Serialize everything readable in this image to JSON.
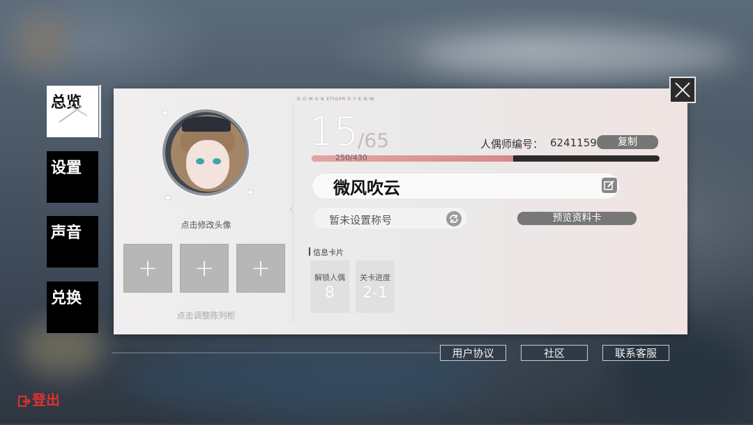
{
  "nav": {
    "items": [
      {
        "label": "总览",
        "active": true
      },
      {
        "label": "设置",
        "active": false
      },
      {
        "label": "声音",
        "active": false
      },
      {
        "label": "兑换",
        "active": false
      }
    ]
  },
  "profile": {
    "avatar_caption": "点击修改头像",
    "showcase_caption": "点击调整陈列柜",
    "slot_symbol": "+"
  },
  "header": {
    "code_text": "D·O·M·E·N  ETIOPR·E·Y·E·N·W",
    "level": "15",
    "level_max": "/65",
    "exp_text": "250/430",
    "exp_progress": 0.58,
    "id_label": "人偶师编号：",
    "id_value": "6241159",
    "copy_label": "复制"
  },
  "name": {
    "value": "微风吹云"
  },
  "title_row": {
    "title_text": "暂未设置称号",
    "preview_label": "预览资料卡"
  },
  "info": {
    "section_label": "信息卡片",
    "cards": [
      {
        "label": "解锁人偶",
        "value": "8"
      },
      {
        "label": "关卡进度",
        "value": "2-1"
      }
    ]
  },
  "footer": {
    "user_agreement": "用户协议",
    "community": "社区",
    "support": "联系客服",
    "logout": "登出"
  },
  "colors": {
    "exp_fill": "#d48a8b",
    "logout": "#e0312f",
    "button_gray": "#767676"
  }
}
